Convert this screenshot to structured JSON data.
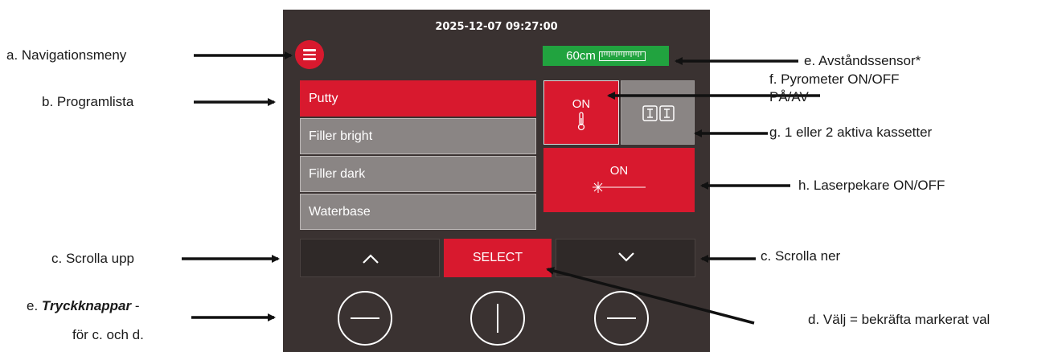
{
  "screen": {
    "datetime": "2025-12-07 09:27:00",
    "distance": "60cm",
    "programs": [
      "Putty",
      "Filler bright",
      "Filler dark",
      "Waterbase"
    ],
    "selected_program": "Putty",
    "pyrometer_state": "ON",
    "laser_state": "ON",
    "select_label": "SELECT"
  },
  "annotations": {
    "a": "a. Navigationsmeny",
    "b": "b. Programlista",
    "c_up": "c. Scrolla upp",
    "c_down": "c. Scrolla ner",
    "e_buttons_bold": "Tryckknappar",
    "e_buttons_prefix": "e.",
    "e_buttons_suffix": "-",
    "e_buttons_line2": "för c. och d.",
    "e_sensor": "e. Avståndssensor*",
    "f_line1": "f.  Pyrometer ON/OFF",
    "f_line2": "PÅ/AV",
    "g": "g. 1 eller 2 aktiva kassetter",
    "h": "h. Laserpekare ON/OFF",
    "d": "d. Välj = bekräfta markerat val"
  },
  "colors": {
    "panel": "#3a3231",
    "accent_red": "#d8192e",
    "green": "#21a33f",
    "gray_row": "#8a8584"
  },
  "icons": [
    "hamburger-menu-icon",
    "ruler-icon",
    "thermometer-icon",
    "cassette-icon",
    "laser-icon",
    "chevron-up-icon",
    "chevron-down-icon"
  ]
}
